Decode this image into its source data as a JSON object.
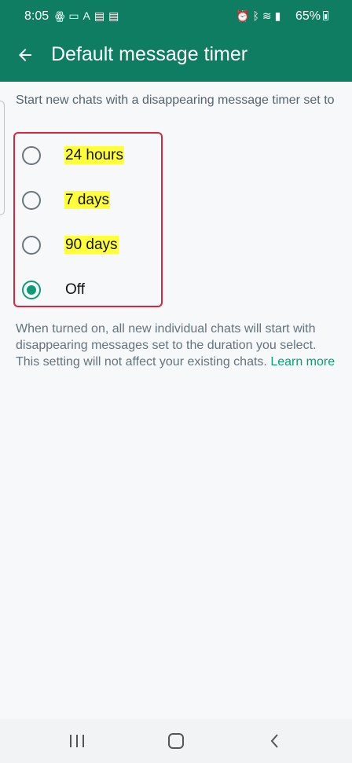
{
  "status_bar": {
    "time": "8:05",
    "battery": "65%",
    "left_icons": [
      "people-icon",
      "message-icon",
      "a-icon",
      "sim-icon",
      "sim2-icon"
    ],
    "right_icons": [
      "alarm-icon",
      "bluetooth-icon",
      "wifi-icon",
      "signal-icon",
      "battery-icon"
    ]
  },
  "app_bar": {
    "title": "Default message timer",
    "back_icon": "arrow-left-icon"
  },
  "content": {
    "section_header": "Start new chats with a disappearing message timer set to",
    "options": [
      {
        "label": "24 hours",
        "selected": false,
        "highlighted": true
      },
      {
        "label": "7 days",
        "selected": false,
        "highlighted": true
      },
      {
        "label": "90 days",
        "selected": false,
        "highlighted": true
      },
      {
        "label": "Off",
        "selected": true,
        "highlighted": false
      }
    ],
    "info_text": "When turned on, all new individual chats will start with disappearing messages set to the duration you select. This setting will not affect your existing chats.",
    "learn_more": "Learn more"
  },
  "nav_bar": {
    "recent_icon": "recent-apps-icon",
    "home_icon": "home-icon",
    "back_icon": "back-icon"
  },
  "colors": {
    "header": "#0f7d62",
    "accent": "#0f9b77",
    "highlight": "#ffff3a",
    "annotation_border": "#d7263d"
  }
}
